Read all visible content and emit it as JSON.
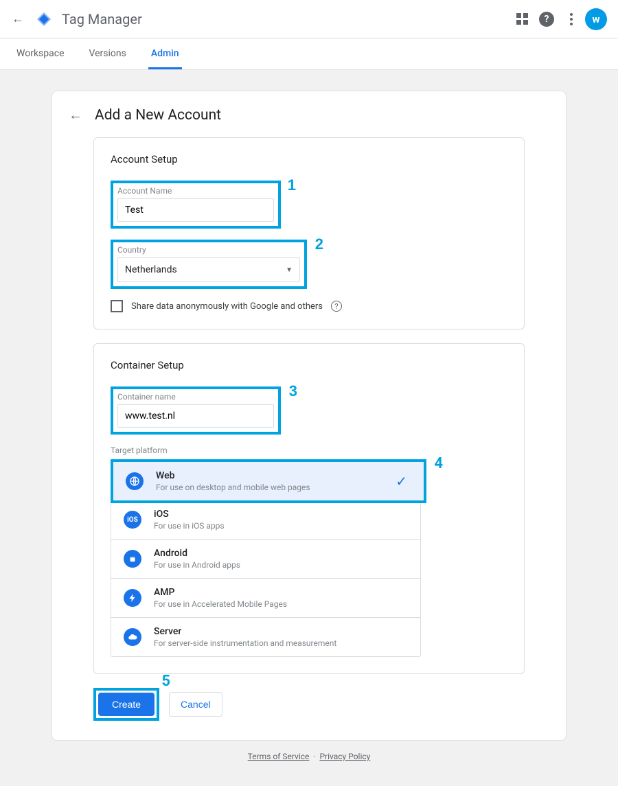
{
  "header": {
    "title": "Tag Manager",
    "avatar_letter": "w"
  },
  "tabs": {
    "workspace": "Workspace",
    "versions": "Versions",
    "admin": "Admin"
  },
  "page": {
    "title": "Add a New Account"
  },
  "account": {
    "section_title": "Account Setup",
    "name_label": "Account Name",
    "name_value": "Test",
    "country_label": "Country",
    "country_value": "Netherlands",
    "share_label": "Share data anonymously with Google and others"
  },
  "container": {
    "section_title": "Container Setup",
    "name_label": "Container name",
    "name_value": "www.test.nl",
    "target_label": "Target platform"
  },
  "platforms": [
    {
      "name": "Web",
      "desc": "For use on desktop and mobile web pages",
      "icon": "globe",
      "selected": true
    },
    {
      "name": "iOS",
      "desc": "For use in iOS apps",
      "icon": "ios",
      "selected": false
    },
    {
      "name": "Android",
      "desc": "For use in Android apps",
      "icon": "android",
      "selected": false
    },
    {
      "name": "AMP",
      "desc": "For use in Accelerated Mobile Pages",
      "icon": "bolt",
      "selected": false
    },
    {
      "name": "Server",
      "desc": "For server-side instrumentation and measurement",
      "icon": "cloud",
      "selected": false
    }
  ],
  "buttons": {
    "create": "Create",
    "cancel": "Cancel"
  },
  "annotations": {
    "n1": "1",
    "n2": "2",
    "n3": "3",
    "n4": "4",
    "n5": "5"
  },
  "footer": {
    "tos": "Terms of Service",
    "sep": "·",
    "pp": "Privacy Policy"
  }
}
